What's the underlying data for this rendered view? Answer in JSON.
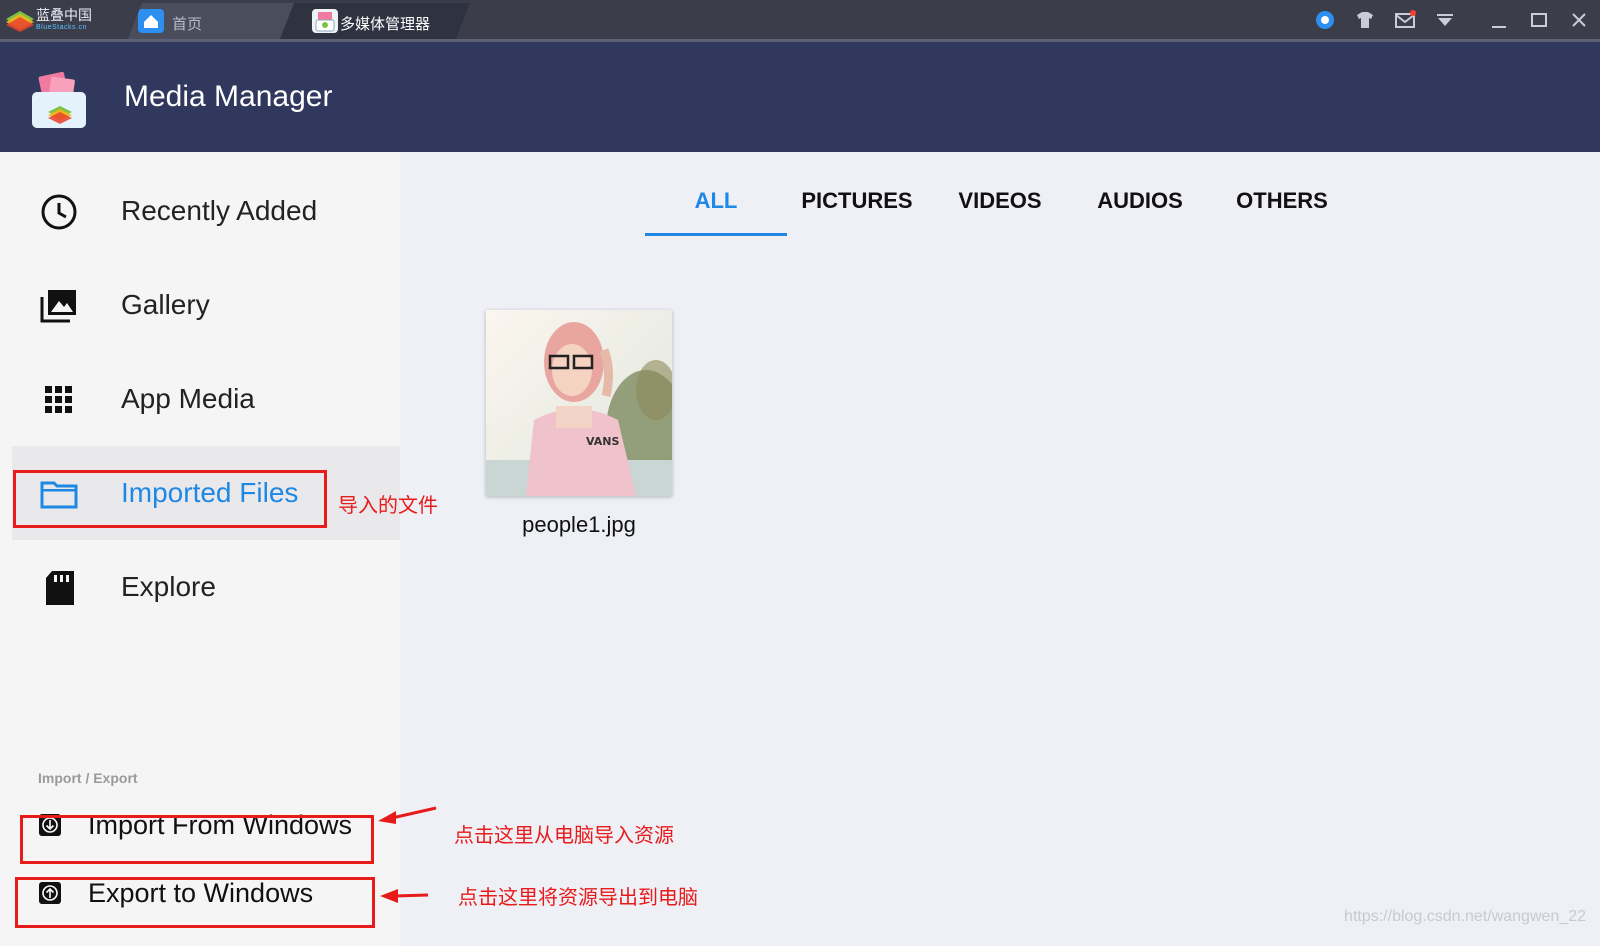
{
  "titlebar": {
    "brand": "蓝叠中国",
    "brand_sub": "BlueStacks.cn",
    "tabs": [
      {
        "label": "首页",
        "icon": "home-icon"
      },
      {
        "label": "多媒体管理器",
        "icon": "media-manager-icon"
      }
    ],
    "icons": [
      "account-icon",
      "tshirt-icon",
      "mail-icon",
      "dropdown-icon",
      "minimize-icon",
      "maximize-icon",
      "close-icon"
    ]
  },
  "header": {
    "title": "Media Manager"
  },
  "sidebar": {
    "items": [
      {
        "label": "Recently Added",
        "icon": "clock-icon"
      },
      {
        "label": "Gallery",
        "icon": "gallery-icon"
      },
      {
        "label": "App Media",
        "icon": "grid-icon"
      },
      {
        "label": "Imported Files",
        "icon": "folder-icon",
        "active": true
      },
      {
        "label": "Explore",
        "icon": "sd-card-icon"
      }
    ],
    "section_label": "Import / Export",
    "import_label": "Import From Windows",
    "export_label": "Export to Windows"
  },
  "filter_tabs": [
    "ALL",
    "PICTURES",
    "VIDEOS",
    "AUDIOS",
    "OTHERS"
  ],
  "active_tab": "ALL",
  "files": [
    {
      "name": "people1.jpg"
    }
  ],
  "annotations": {
    "imported": "导入的文件",
    "import": "点击这里从电脑导入资源",
    "export": "点击这里将资源导出到电脑"
  },
  "watermark": "https://blog.csdn.net/wangwen_22",
  "colors": {
    "accent": "#1e88e5",
    "header": "#30385d",
    "annotation": "#e81b1b"
  }
}
